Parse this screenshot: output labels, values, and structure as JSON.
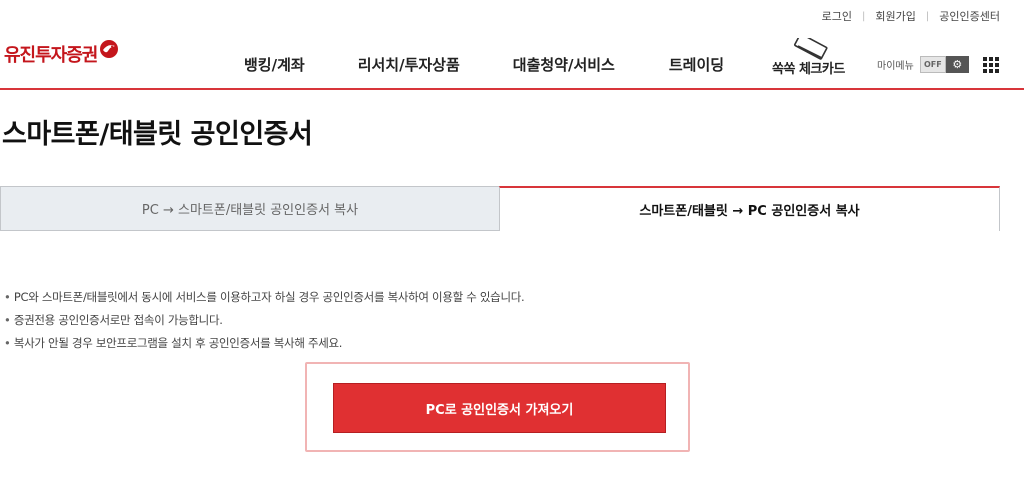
{
  "utility": {
    "login": "로그인",
    "join": "회원가입",
    "cert_center": "공인인증센터"
  },
  "logo": {
    "text": "유진투자증권",
    "mark_icon": "bird-logo-icon",
    "brand_color": "#c4161c"
  },
  "gnb": {
    "items": [
      "뱅킹/계좌",
      "리서치/투자상품",
      "대출청약/서비스",
      "트레이딩"
    ],
    "card_link": "쏙쏙 체크카드"
  },
  "mymenu": {
    "label": "마이메뉴",
    "toggle_state": "OFF",
    "settings_icon": "gear-icon",
    "all_menu_icon": "grid-icon"
  },
  "page": {
    "title": "스마트폰/태블릿 공인인증서"
  },
  "tabs": [
    {
      "label": "PC → 스마트폰/태블릿 공인인증서 복사",
      "active": false
    },
    {
      "label": "스마트폰/태블릿 → PC 공인인증서 복사",
      "active": true
    }
  ],
  "notes": [
    "PC와 스마트폰/태블릿에서 동시에 서비스를 이용하고자 하실 경우 공인인증서를 복사하여 이용할 수 있습니다.",
    "증권전용 공인인증서로만 접속이 가능합니다.",
    "복사가 안될 경우 보안프로그램을 설치 후 공인인증서를 복사해 주세요."
  ],
  "action": {
    "button_label": "PC로 공인인증서 가져오기"
  },
  "colors": {
    "accent": "#d8353a",
    "button": "#e03032",
    "tab_inactive_bg": "#e9edf1"
  }
}
